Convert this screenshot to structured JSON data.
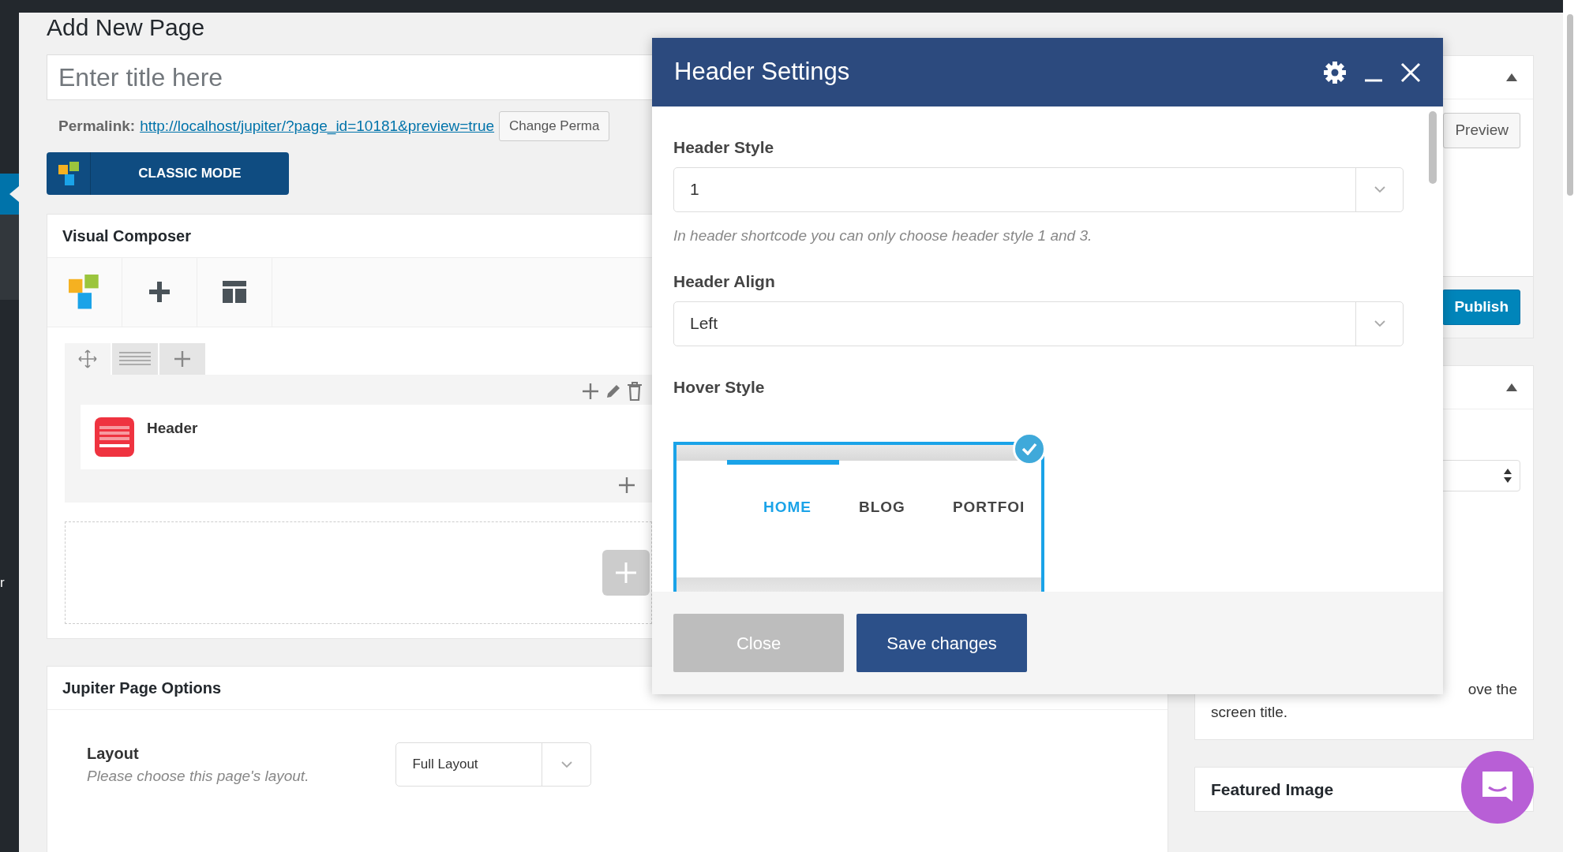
{
  "page_title": "Add New Page",
  "title_field": {
    "placeholder": "Enter title here"
  },
  "permalink": {
    "label": "Permalink:",
    "url": "http://localhost/jupiter/?page_id=10181&preview=true",
    "button": "Change Perma"
  },
  "classic_mode_button": "CLASSIC MODE",
  "admin_menu": {
    "fragment": "r"
  },
  "visual_composer": {
    "title": "Visual Composer",
    "element": {
      "name": "Header"
    }
  },
  "jupiter_page_options": {
    "title": "Jupiter Page Options",
    "fields": [
      {
        "label": "Layout",
        "help": "Please choose this page's layout.",
        "value": "Full Layout"
      }
    ]
  },
  "sidebar": {
    "preview_button": "Preview",
    "publish_button": "Publish",
    "help_lines": [
      "ove the",
      "screen title."
    ],
    "featured_image": "Featured Image"
  },
  "modal": {
    "title": "Header Settings",
    "fields": [
      {
        "kind": "select",
        "label": "Header Style",
        "value": "1",
        "help": "In header shortcode you can only choose header style 1 and 3."
      },
      {
        "kind": "select",
        "label": "Header Align",
        "value": "Left"
      },
      {
        "kind": "image_choice",
        "label": "Hover Style",
        "options": [
          {
            "selected": true,
            "items": [
              {
                "label": "HOME",
                "active": true
              },
              {
                "label": "BLOG",
                "active": false
              },
              {
                "label": "PORTFOI",
                "active": false
              }
            ]
          }
        ]
      }
    ],
    "buttons": [
      {
        "kind": "secondary",
        "label": "Close"
      },
      {
        "kind": "primary",
        "label": "Save changes"
      }
    ]
  }
}
